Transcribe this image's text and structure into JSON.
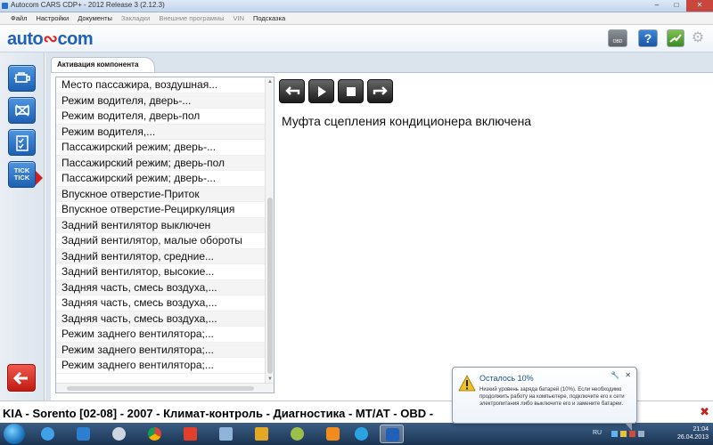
{
  "window": {
    "title": "Autocom CARS CDP+ - 2012 Release 3 (2.12.3)",
    "controls": {
      "minimize": "–",
      "maximize": "□",
      "close": "✕"
    }
  },
  "menu": {
    "items": [
      {
        "label": "Файл",
        "enabled": true
      },
      {
        "label": "Настройки",
        "enabled": true
      },
      {
        "label": "Документы",
        "enabled": true
      },
      {
        "label": "Закладки",
        "enabled": false
      },
      {
        "label": "Внешние программы",
        "enabled": false
      },
      {
        "label": "VIN",
        "enabled": false
      },
      {
        "label": "Подсказка",
        "enabled": true
      }
    ]
  },
  "toolbar": {
    "logo_left": "auto",
    "logo_accent": "∾",
    "logo_right": "com",
    "obd_label": "OBD",
    "icons": [
      "obd-icon",
      "help-icon",
      "settings-icon",
      "gear-icon"
    ]
  },
  "leftbar": {
    "buttons": [
      "engine-icon",
      "ecu-disabled-icon",
      "checklist-icon",
      "tick-tick-icon"
    ],
    "tick_label_1": "TICK",
    "tick_label_2": "TICK",
    "back_icon": "back-arrow-icon"
  },
  "main": {
    "tab_label": "Активация компонента",
    "list_items": [
      "Место пассажира, воздушная...",
      "Режим водителя, дверь-...",
      "Режим водителя, дверь-пол",
      "Режим водителя,...",
      "Пассажирский режим; дверь-...",
      "Пассажирский режим; дверь-пол",
      "Пассажирский режим; дверь-...",
      "Впускное отверстие-Приток",
      "Впускное отверстие-Рециркуляция",
      "Задний вентилятор выключен",
      "Задний вентилятор, малые обороты",
      "Задний вентилятор, средние...",
      "Задний вентилятор, высокие...",
      "Задняя часть, смесь воздуха,...",
      "Задняя часть, смесь воздуха,...",
      "Задняя часть, смесь воздуха,...",
      "Режим заднего вентилятора;...",
      "Режим заднего вентилятора;...",
      "Режим заднего вентилятора;..."
    ],
    "action_buttons": [
      "undo-icon",
      "play-icon",
      "stop-icon",
      "redo-icon"
    ],
    "status_text": "Муфта сцепления кондиционера включена"
  },
  "statusline": {
    "breadcrumb": "KIA - Sorento [02-08] - 2007 - Климат-контроль - Диагностика - MT/AT - OBD -",
    "close": "✖"
  },
  "balloon": {
    "title": "Осталось 10%",
    "text": "Низкий уровень заряда батарей (10%). Если необходимо продолжить работу на компьютере, подключите его к сети электропитания либо выключите его и замените батареи.",
    "close": "✕",
    "options": "🔧"
  },
  "taskbar": {
    "apps": [
      "ie-icon",
      "media-player-icon",
      "itunes-icon",
      "chrome-icon",
      "yandex-icon",
      "volume-app-icon",
      "outlook-icon",
      "paint-icon",
      "odnoklassniki-icon",
      "skype-icon",
      "autocom-icon"
    ],
    "language": "RU",
    "time": "21:04",
    "date": "26.04.2013"
  },
  "colors": {
    "accent": "#1f60b8",
    "logo_red": "#e2231a",
    "close_red": "#c9463d",
    "panel_bg": "#dbe3ec"
  }
}
